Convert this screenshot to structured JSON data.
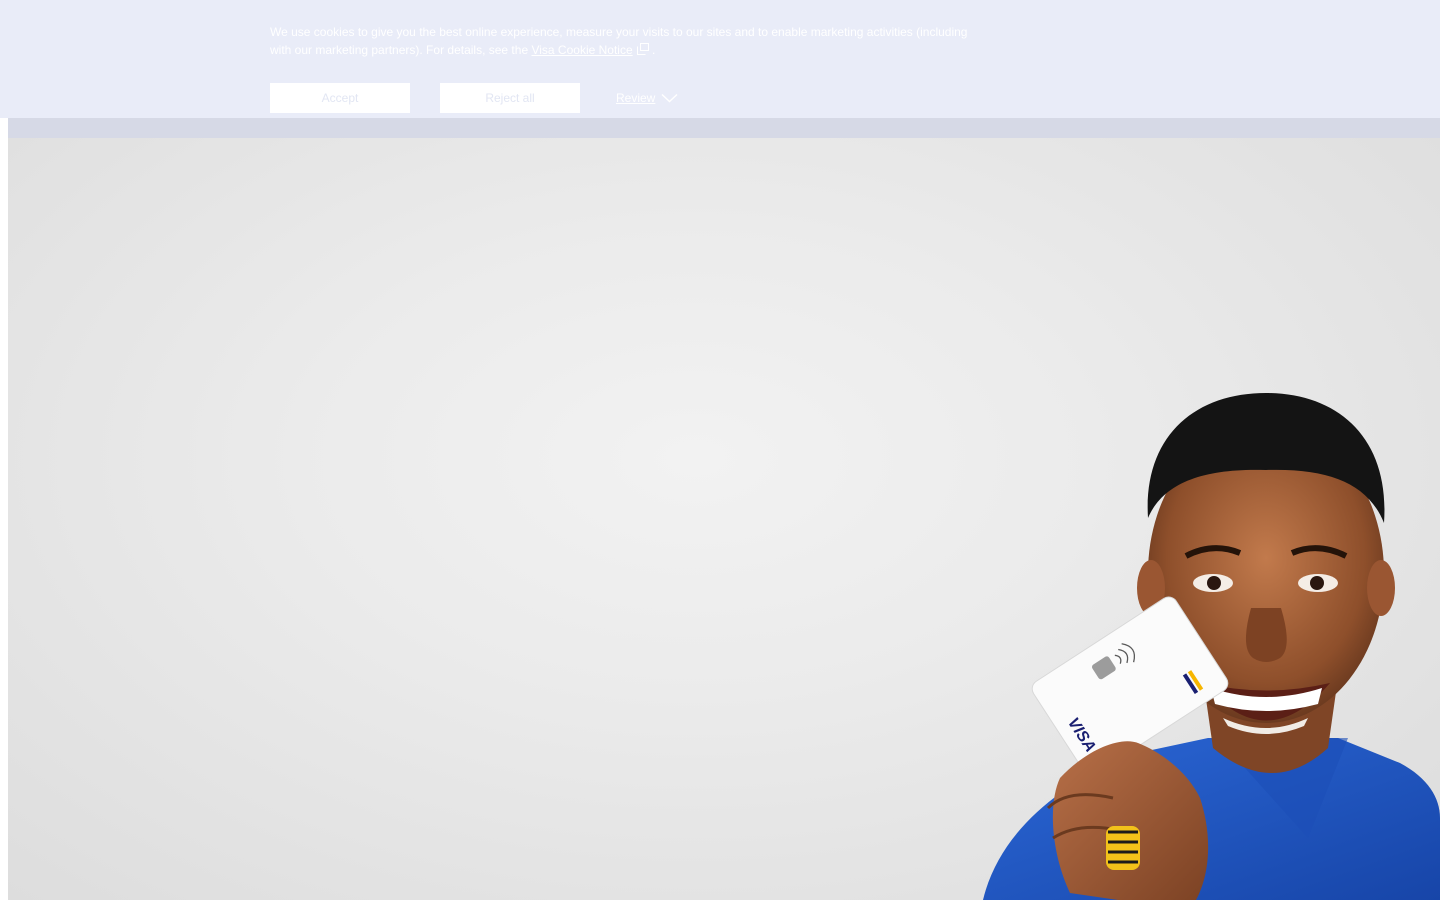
{
  "cookie_banner": {
    "text": "We use cookies to give you the best online experience, measure your visits to our sites and to enable marketing activities (including with our marketing partners). For details, see the",
    "notice_link": "Visa Cookie Notice",
    "text_end": ".",
    "accept_label": "Accept",
    "reject_label": "Reject all",
    "review_label": "Review"
  },
  "hero": {
    "card_brand": "VISA"
  },
  "colors": {
    "banner_bg": "#e9ecf8",
    "hero_bg": "#e6e6e6",
    "shirt_blue": "#1f57c4",
    "visa_blue": "#1a1f71",
    "visa_gold": "#f7b600"
  }
}
